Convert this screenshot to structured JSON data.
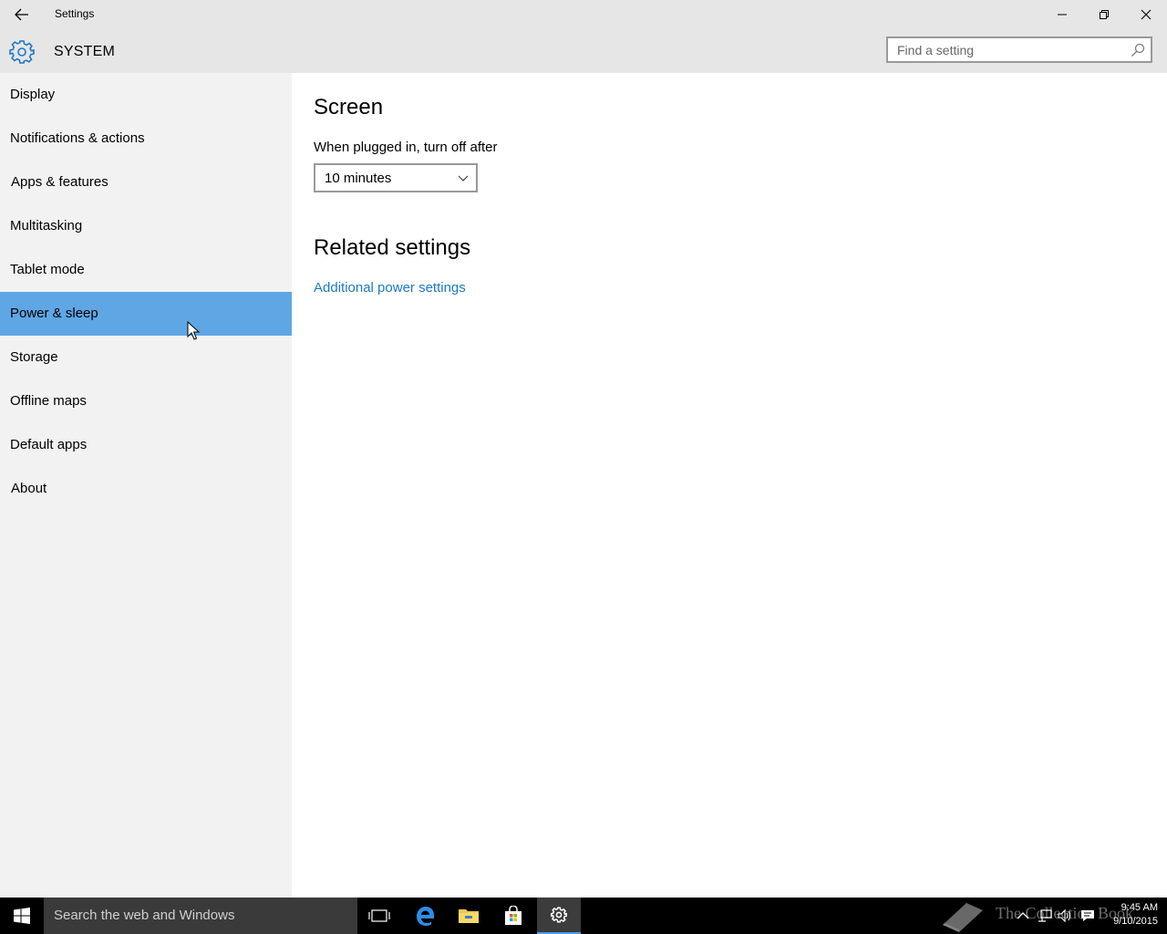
{
  "window": {
    "title": "Settings",
    "back_icon": "back-arrow-icon",
    "controls": [
      "minimize-icon",
      "restore-icon",
      "close-icon"
    ]
  },
  "header": {
    "icon": "gear-icon",
    "section": "SYSTEM",
    "search_placeholder": "Find a setting"
  },
  "sidebar": {
    "items": [
      {
        "label": "Display"
      },
      {
        "label": "Notifications & actions"
      },
      {
        "label": "Apps & features"
      },
      {
        "label": "Multitasking"
      },
      {
        "label": "Tablet mode"
      },
      {
        "label": "Power & sleep",
        "selected": true
      },
      {
        "label": "Storage"
      },
      {
        "label": "Offline maps"
      },
      {
        "label": "Default apps"
      },
      {
        "label": "About"
      }
    ]
  },
  "main": {
    "screen_heading": "Screen",
    "plugged_label": "When plugged in, turn off after",
    "plugged_value": "10 minutes",
    "related_heading": "Related settings",
    "power_link": "Additional power settings"
  },
  "taskbar": {
    "search_placeholder": "Search the web and Windows",
    "watermark": "The Collection Book",
    "time": "9:45 AM",
    "date": "9/10/2015"
  },
  "colors": {
    "accent": "#5fa6e4",
    "link": "#1d78c8",
    "sidebar_bg": "#f2f2f2",
    "titlebar_bg": "#e6e6e6",
    "taskbar_bg": "#000000"
  }
}
